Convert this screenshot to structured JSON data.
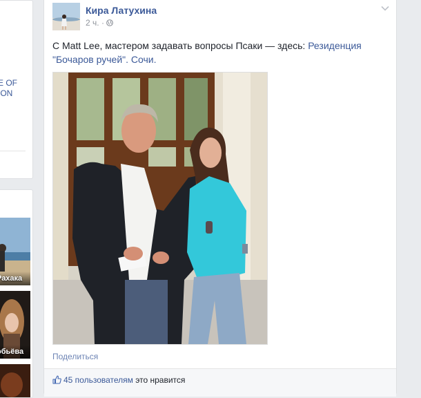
{
  "left_column": {
    "cut_text": "E OF\nION",
    "friends": [
      {
        "name": "Рахака"
      },
      {
        "name": "обьёва"
      }
    ]
  },
  "post": {
    "author": "Кира Латухина",
    "time": "2 ч.",
    "text_before": "C Matt Lee, мастером задавать вопросы Псаки — здесь: ",
    "place_link": "Резиденция \"Бочаров ручей\". Сочи.",
    "share_label": "Поделиться",
    "likes_count": "45 пользователям",
    "likes_suffix": " это нравится",
    "colors": {
      "link": "#3b5998",
      "meta": "#90949c"
    }
  }
}
